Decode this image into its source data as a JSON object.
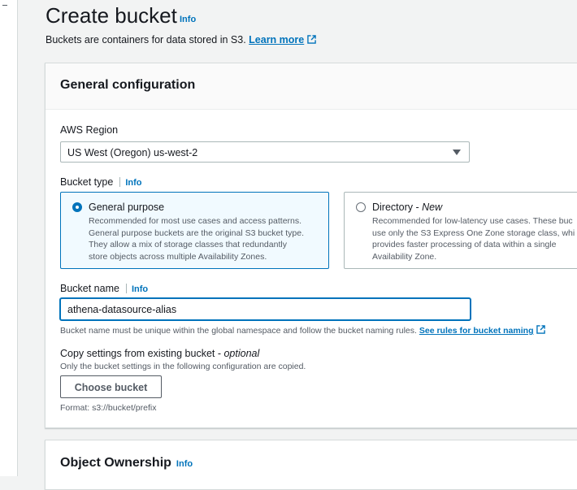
{
  "header": {
    "title": "Create bucket",
    "info": "Info",
    "description": "Buckets are containers for data stored in S3.",
    "learn_more": "Learn more"
  },
  "general": {
    "title": "General configuration",
    "region_label": "AWS Region",
    "region_value": "US West (Oregon) us-west-2",
    "bucket_type_label": "Bucket type",
    "bucket_type_info": "Info",
    "options": [
      {
        "title": "General purpose",
        "desc": [
          "Recommended for most use cases and access patterns.",
          "General purpose buckets are the original S3 bucket type.",
          "They allow a mix of storage classes that redundantly",
          "store objects across multiple Availability Zones."
        ]
      },
      {
        "title": "Directory - ",
        "title_suffix": "New",
        "desc": [
          "Recommended for low-latency use cases. These buc",
          "use only the S3 Express One Zone storage class, whi",
          "provides faster processing of data within a single",
          "Availability Zone."
        ]
      }
    ],
    "bucket_name_label": "Bucket name",
    "bucket_name_info": "Info",
    "bucket_name_value": "athena-datasource-alias",
    "bucket_name_hint": "Bucket name must be unique within the global namespace and follow the bucket naming rules.",
    "bucket_name_link": "See rules for bucket naming",
    "copy_label": "Copy settings from existing bucket - ",
    "copy_optional": "optional",
    "copy_hint": "Only the bucket settings in the following configuration are copied.",
    "choose_button": "Choose bucket",
    "format_hint": "Format: s3://bucket/prefix"
  },
  "ownership": {
    "title": "Object Ownership",
    "info": "Info"
  },
  "colors": {
    "link": "#0073bb",
    "selected_tile_bg": "#f1faff",
    "page_bg": "#f2f3f3"
  },
  "icons": [
    "external-link-icon",
    "radio-selected-icon",
    "radio-unselected-icon",
    "dropdown-caret-icon"
  ]
}
